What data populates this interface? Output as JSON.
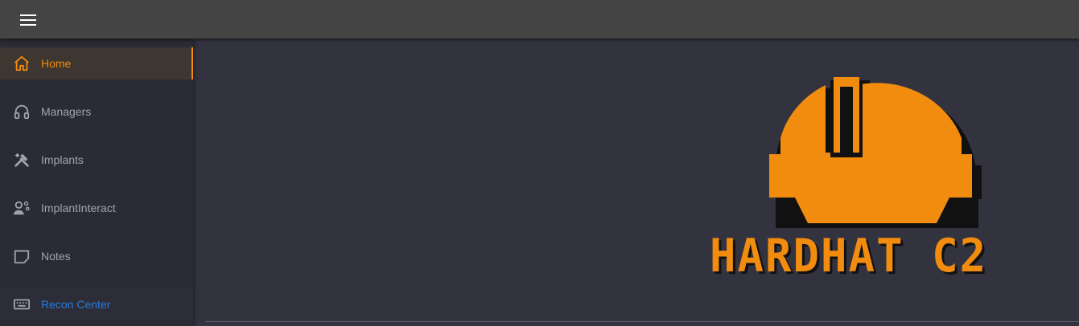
{
  "topbar": {
    "menu_icon": "hamburger-menu-icon"
  },
  "sidebar": {
    "items": [
      {
        "label": "Home",
        "icon": "home-icon",
        "active": true
      },
      {
        "label": "Managers",
        "icon": "headphones-icon"
      },
      {
        "label": "Implants",
        "icon": "tools-icon"
      },
      {
        "label": "ImplantInteract",
        "icon": "user-gear-icon"
      },
      {
        "label": "Notes",
        "icon": "note-icon"
      },
      {
        "label": "Recon Center",
        "icon": "keyboard-icon"
      }
    ]
  },
  "main": {
    "logo_text": "HARDHAT C2"
  },
  "colors": {
    "accent": "#f28c0f",
    "link": "#2a7bd3",
    "background": "#32333f",
    "sidebar": "#2a2b35",
    "topbar": "#444444"
  }
}
